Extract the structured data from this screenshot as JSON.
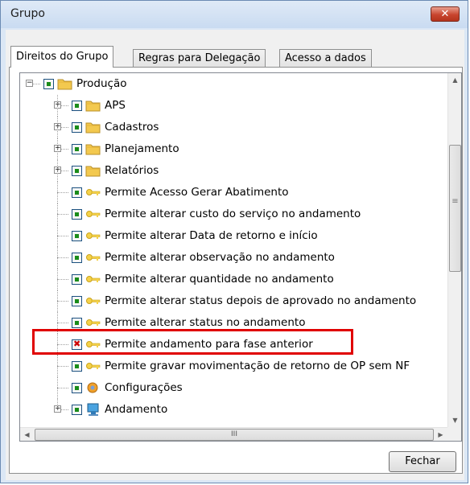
{
  "window": {
    "title": "Grupo",
    "close_glyph": "✕"
  },
  "tabs": [
    {
      "label": "Direitos do Grupo",
      "active": true
    },
    {
      "label": "Regras para Delegação",
      "active": false
    },
    {
      "label": "Acesso a dados",
      "active": false
    }
  ],
  "tree": {
    "items": [
      {
        "label": "Produção",
        "icon": "folder-icon",
        "checked": "green",
        "expander": "minus"
      },
      {
        "label": "APS",
        "icon": "folder-icon",
        "checked": "green",
        "expander": "plus"
      },
      {
        "label": "Cadastros",
        "icon": "folder-icon",
        "checked": "green",
        "expander": "plus"
      },
      {
        "label": "Planejamento",
        "icon": "folder-icon",
        "checked": "green",
        "expander": "plus"
      },
      {
        "label": "Relatórios",
        "icon": "folder-icon",
        "checked": "green",
        "expander": "plus"
      },
      {
        "label": "Permite Acesso Gerar Abatimento",
        "icon": "key-icon",
        "checked": "green",
        "expander": "none"
      },
      {
        "label": "Permite alterar custo do serviço no andamento",
        "icon": "key-icon",
        "checked": "green",
        "expander": "none"
      },
      {
        "label": "Permite alterar Data de retorno e início",
        "icon": "key-icon",
        "checked": "green",
        "expander": "none"
      },
      {
        "label": "Permite alterar observação no andamento",
        "icon": "key-icon",
        "checked": "green",
        "expander": "none"
      },
      {
        "label": "Permite alterar quantidade no andamento",
        "icon": "key-icon",
        "checked": "green",
        "expander": "none"
      },
      {
        "label": "Permite alterar status depois de aprovado no andamento",
        "icon": "key-icon",
        "checked": "green",
        "expander": "none"
      },
      {
        "label": "Permite alterar status no andamento",
        "icon": "key-icon",
        "checked": "green",
        "expander": "none"
      },
      {
        "label": "Permite andamento para fase anterior",
        "icon": "key-icon",
        "checked": "red-x",
        "expander": "none"
      },
      {
        "label": "Permite gravar movimentação de retorno de OP sem NF",
        "icon": "key-icon",
        "checked": "green",
        "expander": "none"
      },
      {
        "label": "Configurações",
        "icon": "settings-icon",
        "checked": "green",
        "expander": "none"
      },
      {
        "label": "Andamento",
        "icon": "computer-icon",
        "checked": "green",
        "expander": "plus"
      }
    ]
  },
  "scrollbar": {
    "grip": "≡",
    "h_grip": "III"
  },
  "buttons": {
    "close_label": "Fechar"
  },
  "colors": {
    "highlight": "#e00000",
    "check_green": "#1a8c1a",
    "check_red": "#cc0000",
    "folder": "#f3c94f"
  }
}
